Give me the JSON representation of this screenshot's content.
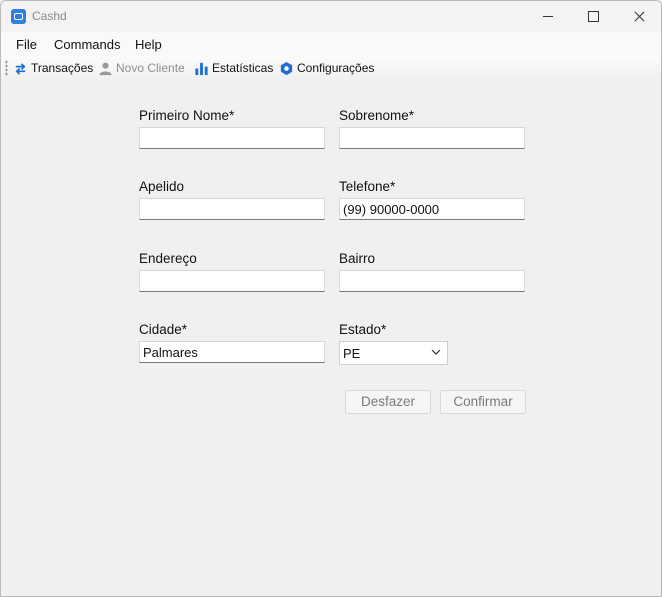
{
  "window": {
    "title": "Cashd"
  },
  "menu": {
    "file": "File",
    "commands": "Commands",
    "help": "Help"
  },
  "toolbar": {
    "transactions": "Transações",
    "new_client": "Novo Cliente",
    "statistics": "Estatísticas",
    "settings": "Configurações"
  },
  "form": {
    "first_name": {
      "label": "Primeiro Nome*",
      "value": ""
    },
    "last_name": {
      "label": "Sobrenome*",
      "value": ""
    },
    "nickname": {
      "label": "Apelido",
      "value": ""
    },
    "phone": {
      "label": "Telefone*",
      "value": "(99) 90000-0000"
    },
    "address": {
      "label": "Endereço",
      "value": ""
    },
    "district": {
      "label": "Bairro",
      "value": ""
    },
    "city": {
      "label": "Cidade*",
      "value": "Palmares"
    },
    "state": {
      "label": "Estado*",
      "value": "PE"
    }
  },
  "actions": {
    "undo": "Desfazer",
    "confirm": "Confirmar"
  },
  "colors": {
    "accent": "#2f7fe0",
    "icon_blue": "#1f6fd1"
  }
}
